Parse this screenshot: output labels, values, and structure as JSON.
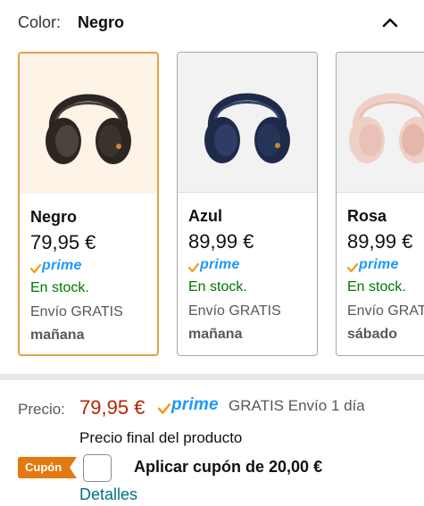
{
  "color_selector": {
    "label": "Color:",
    "selected_value": "Negro",
    "collapse_icon": "chevron-up-icon"
  },
  "variants": [
    {
      "name": "Negro",
      "price": "79,95 €",
      "prime": "prime",
      "stock": "En stock.",
      "shipping": "Envío GRATIS",
      "delivery": "mañana",
      "selected": true,
      "color_hex": "#2b2622"
    },
    {
      "name": "Azul",
      "price": "89,99 €",
      "prime": "prime",
      "stock": "En stock.",
      "shipping": "Envío GRATIS",
      "delivery": "mañana",
      "selected": false,
      "color_hex": "#1f2a4a"
    },
    {
      "name": "Rosa",
      "price": "89,99 €",
      "prime": "prime",
      "stock": "En stock.",
      "shipping": "Envío GRATIS",
      "delivery": "sábado",
      "selected": false,
      "color_hex": "#f0d0c6"
    }
  ],
  "buybox": {
    "price_label": "Precio:",
    "price": "79,95 €",
    "prime": "prime",
    "shipping": "GRATIS Envío 1 día",
    "final_price_note": "Precio final del producto"
  },
  "coupon": {
    "badge": "Cupón",
    "text": "Aplicar cupón de 20,00 €",
    "checked": false,
    "details_link": "Detalles"
  },
  "colors": {
    "price_red": "#b12704",
    "stock_green": "#007600",
    "prime_blue": "#1a98ff",
    "link_teal": "#007185",
    "selected_border": "#e2a04a",
    "coupon_orange": "#e47911"
  }
}
